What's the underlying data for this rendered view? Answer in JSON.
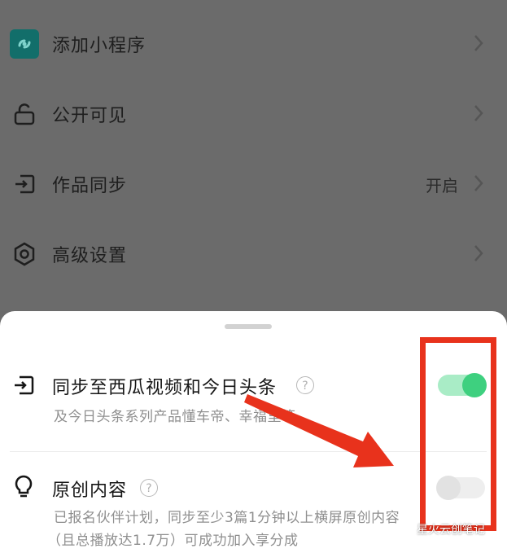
{
  "menu": {
    "items": [
      {
        "label": "添加小程序",
        "value": "",
        "icon": "mini-program-icon"
      },
      {
        "label": "公开可见",
        "value": "",
        "icon": "unlock-icon"
      },
      {
        "label": "作品同步",
        "value": "开启",
        "icon": "sync-login-icon"
      },
      {
        "label": "高级设置",
        "value": "",
        "icon": "hexagon-settings-icon"
      }
    ]
  },
  "sheet": {
    "options": [
      {
        "title": "同步至西瓜视频和今日头条",
        "desc": "及今日头条系列产品懂车帝、幸福里等",
        "desc2": "",
        "toggle": "on",
        "icon": "sync-login-icon"
      },
      {
        "title": "原创内容",
        "desc": "已报名伙伴计划，同步至少3篇1分钟以上横屏原创内容",
        "desc2": "（且总播放达1.7万）可成功加入享分成",
        "toggle": "off",
        "icon": "lightbulb-icon"
      }
    ]
  },
  "help_mark": "?",
  "watermark": {
    "text": "星火云创笔记",
    "icon": "wechat-icon"
  },
  "colors": {
    "overlay": "#6b6b6b",
    "toggle_on": "#3ed07f",
    "highlight": "#e8321c",
    "mini_program_bg": "#1aa09a"
  }
}
